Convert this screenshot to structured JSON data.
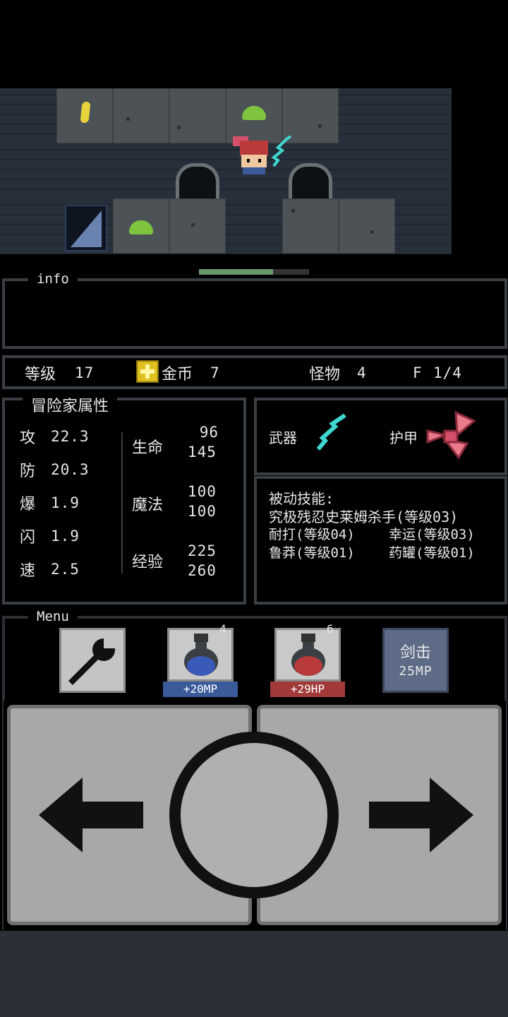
{
  "info": {
    "title": "info",
    "message": ""
  },
  "status": {
    "level_label": "等级",
    "level_value": "17",
    "gold_label": "金币",
    "gold_value": "7",
    "monster_label": "怪物",
    "monster_value": "4",
    "floor_label": "F",
    "floor_value": "1/4",
    "level_progress": 0.67
  },
  "attributes": {
    "title": "冒险家属性",
    "stats": [
      {
        "label": "攻",
        "value": "22.3"
      },
      {
        "label": "防",
        "value": "20.3"
      },
      {
        "label": "爆",
        "value": "1.9"
      },
      {
        "label": "闪",
        "value": "1.9"
      },
      {
        "label": "速",
        "value": "2.5"
      }
    ],
    "life_label": "生命",
    "life_current": "96",
    "life_max": "145",
    "magic_label": "魔法",
    "magic_current": "100",
    "magic_max": "100",
    "exp_label": "经验",
    "exp_current": "225",
    "exp_max": "260"
  },
  "equipment": {
    "weapon_label": "武器",
    "armor_label": "护甲"
  },
  "skills": {
    "title": "被动技能:",
    "line1": "究极残忍史莱姆杀手(等级03)",
    "line2a": "耐打(等级04)",
    "line2b": "幸运(等级03)",
    "line3a": "鲁莽(等级01)",
    "line3b": "药罐(等级01)"
  },
  "menu": {
    "title": "Menu",
    "mp_potion_count": "4",
    "mp_potion_label": "+20MP",
    "hp_potion_count": "6",
    "hp_potion_label": "+29HP",
    "skill_name": "剑击",
    "skill_cost": "25MP"
  },
  "colors": {
    "accent_mp": "#3a5a9a",
    "accent_hp": "#a33a3a",
    "skill_btn": "#5e6b86",
    "gold_icon": "#e0c020"
  }
}
